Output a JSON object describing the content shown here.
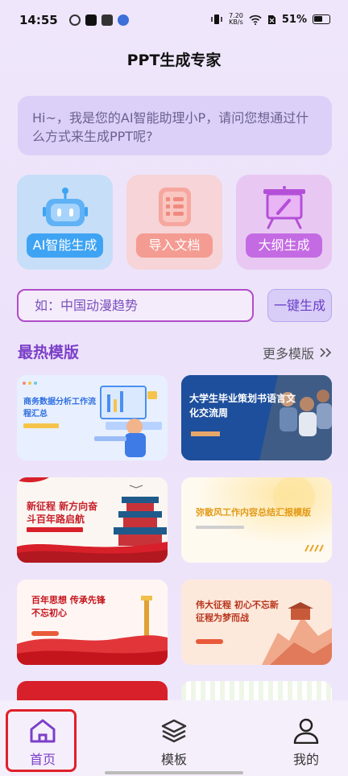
{
  "status": {
    "time": "14:55",
    "net_speed_value": "7.20",
    "net_speed_unit": "KB/s",
    "battery": "51%"
  },
  "app": {
    "title": "PPT生成专家"
  },
  "assistant": {
    "greeting": "Hi~，我是您的AI智能助理小P，请问您想通过什么方式来生成PPT呢?"
  },
  "modes": [
    {
      "label": "AI智能生成",
      "icon": "robot-icon"
    },
    {
      "label": "导入文档",
      "icon": "document-icon"
    },
    {
      "label": "大纲生成",
      "icon": "presentation-board-icon"
    }
  ],
  "prompt": {
    "placeholder": "如：中国动漫趋势",
    "generate_label": "一键生成"
  },
  "hot_templates": {
    "title": "最热模版",
    "more_label": "更多模版",
    "items": [
      {
        "title": "商务数据分析工作流程汇总",
        "subtitle": ""
      },
      {
        "title": "大学生毕业策划书语言文化交流周",
        "subtitle": ""
      },
      {
        "title": "新征程 新方向奋斗百年路启航",
        "subtitle": ""
      },
      {
        "title": "弥散风工作内容总结汇报模版",
        "subtitle": ""
      },
      {
        "title": "百年思想 传承先锋不忘初心",
        "subtitle": ""
      },
      {
        "title": "伟大征程 初心不忘新征程为梦而战",
        "subtitle": ""
      }
    ]
  },
  "nav": {
    "home": "首页",
    "templates": "模板",
    "mine": "我的"
  },
  "colors": {
    "accent": "#7b3fc8",
    "highlight": "#e0202a"
  }
}
